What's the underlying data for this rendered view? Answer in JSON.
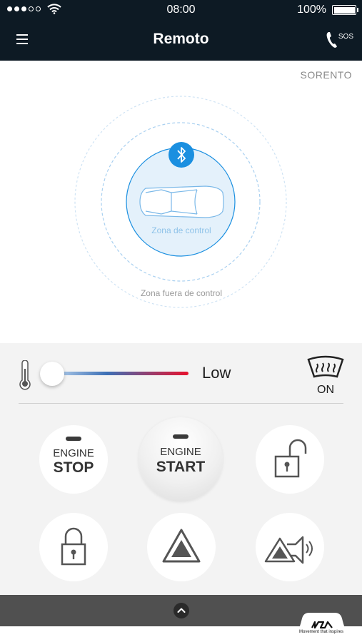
{
  "status_bar": {
    "time": "08:00",
    "battery": "100%"
  },
  "header": {
    "title": "Remoto",
    "sos_label": "SOS"
  },
  "vehicle": {
    "name": "SORENTO"
  },
  "zone": {
    "in_range_label": "Zona de control",
    "out_of_range_label": "Zona fuera de control"
  },
  "climate": {
    "temperature_label": "Low",
    "slider_level": 0,
    "defrost_state": "ON"
  },
  "controls": {
    "engine_stop": {
      "line1": "ENGINE",
      "line2": "STOP"
    },
    "engine_start": {
      "line1": "ENGINE",
      "line2": "START"
    }
  },
  "brand": {
    "tagline": "Movement that inspires"
  },
  "colors": {
    "header_bg": "#0d1a24",
    "zone_blue": "#1a8fe0",
    "slider_cold": "#b8d3ee",
    "slider_hot": "#e8102c",
    "panel_bg": "#f3f3f3"
  },
  "icons": [
    "menu-icon",
    "phone-sos-icon",
    "bluetooth-icon",
    "car-top-icon",
    "thermometer-icon",
    "rear-defrost-icon",
    "unlock-icon",
    "lock-icon",
    "hazard-icon",
    "horn-lights-icon",
    "chevron-up-icon"
  ]
}
